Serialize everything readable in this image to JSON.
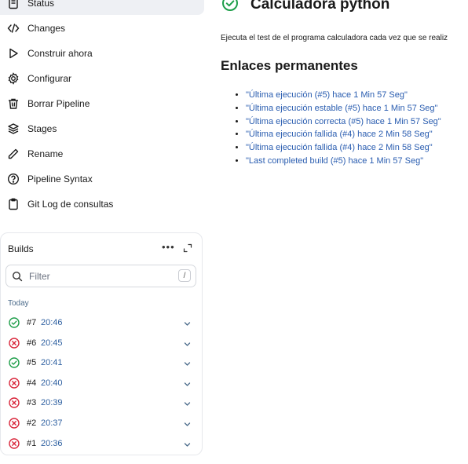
{
  "sidebar": {
    "items": [
      {
        "label": "Status",
        "icon": "document-icon"
      },
      {
        "label": "Changes",
        "icon": "code-icon"
      },
      {
        "label": "Construir ahora",
        "icon": "play-icon"
      },
      {
        "label": "Configurar",
        "icon": "gear-icon"
      },
      {
        "label": "Borrar Pipeline",
        "icon": "trash-icon"
      },
      {
        "label": "Stages",
        "icon": "layers-icon"
      },
      {
        "label": "Rename",
        "icon": "pencil-icon"
      },
      {
        "label": "Pipeline Syntax",
        "icon": "help-icon"
      },
      {
        "label": "Git Log de consultas",
        "icon": "clipboard-icon"
      }
    ]
  },
  "builds": {
    "title": "Builds",
    "more": "•••",
    "filter_placeholder": "Filter",
    "filter_shortcut": "/",
    "group_label": "Today",
    "items": [
      {
        "number": "#7",
        "time": "20:46",
        "status": "success"
      },
      {
        "number": "#6",
        "time": "20:45",
        "status": "failed"
      },
      {
        "number": "#5",
        "time": "20:41",
        "status": "success"
      },
      {
        "number": "#4",
        "time": "20:40",
        "status": "failed"
      },
      {
        "number": "#3",
        "time": "20:39",
        "status": "failed"
      },
      {
        "number": "#2",
        "time": "20:37",
        "status": "failed"
      },
      {
        "number": "#1",
        "time": "20:36",
        "status": "failed"
      }
    ]
  },
  "main": {
    "title": "Calculadora python",
    "description": "Ejecuta el test de el programa calculadora cada vez que se realiz",
    "permalinks_title": "Enlaces permanentes",
    "permalinks": [
      "\"Última ejecución (#5) hace 1 Min 57 Seg\"",
      "\"Última ejecución estable (#5) hace 1 Min 57 Seg\"",
      "\"Última ejecución correcta (#5) hace 1 Min 57 Seg\"",
      "\"Última ejecución fallida (#4) hace 2 Min 58 Seg\"",
      "\"Última ejecución fallida (#4) hace 2 Min 58 Seg\"",
      "\"Last completed build (#5) hace 1 Min 57 Seg\""
    ]
  },
  "colors": {
    "success": "#1e9e4a",
    "failed": "#d9263b",
    "link": "#2a5db0"
  }
}
